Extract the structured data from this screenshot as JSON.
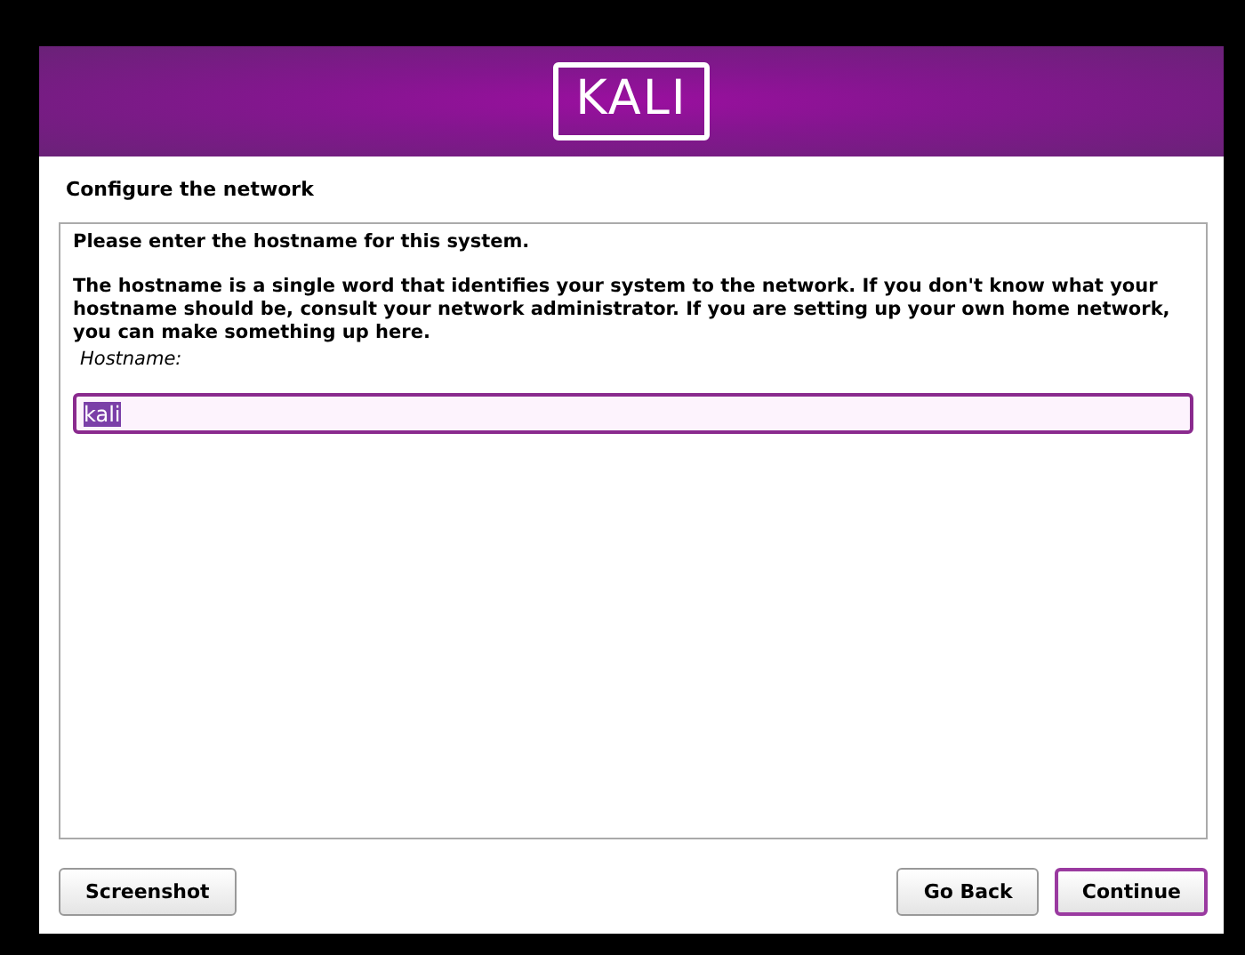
{
  "header": {
    "logo": "KALI"
  },
  "title": "Configure the network",
  "prompt": "Please enter the hostname for this system.",
  "description": "The hostname is a single word that identifies your system to the network. If you don't know what your hostname should be, consult your network administrator. If you are setting up your own home network, you can make something up here.",
  "field": {
    "label": "Hostname:",
    "value": "kali",
    "value_selected": true
  },
  "left_buttons": [
    {
      "label": "Screenshot",
      "focused": false
    }
  ],
  "right_buttons": [
    {
      "label": "Go Back",
      "focused": false
    },
    {
      "label": "Continue",
      "focused": true
    }
  ]
}
